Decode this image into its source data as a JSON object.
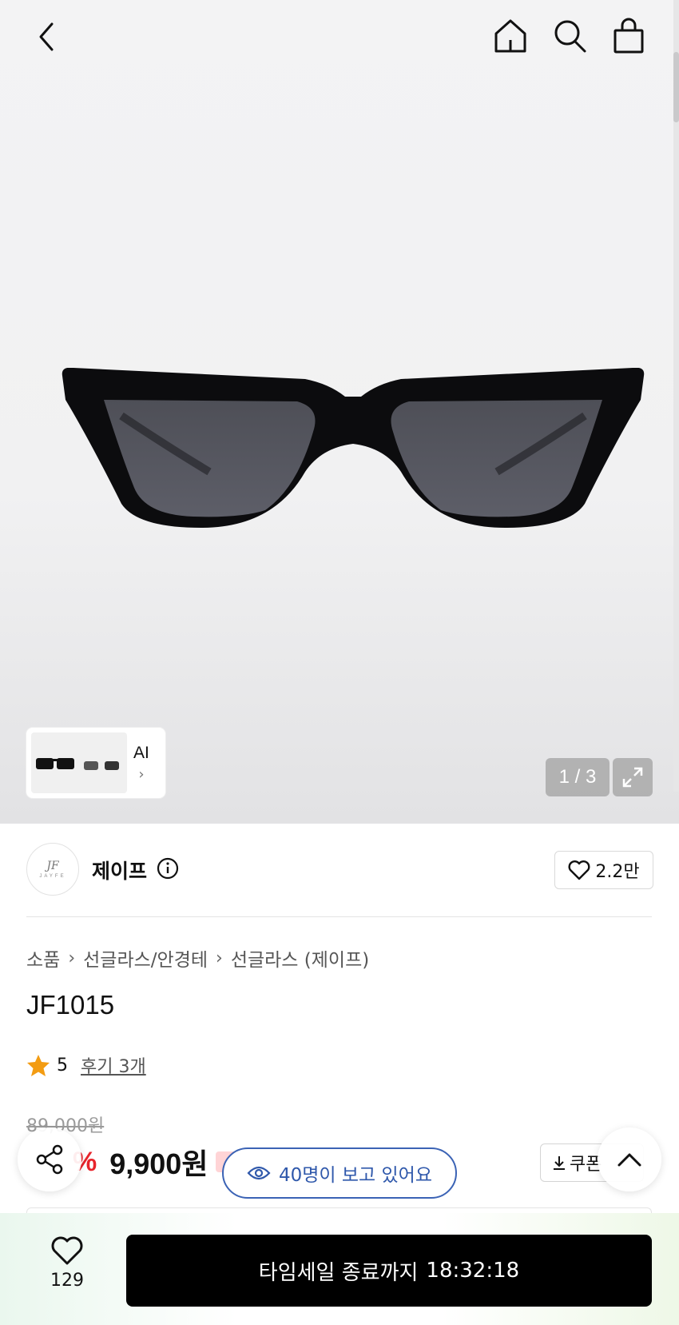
{
  "gallery": {
    "thumb_label": "AI",
    "thumb_chevron": "›",
    "pager": "1 / 3"
  },
  "brand": {
    "name": "제이프",
    "logo_mark": "JF",
    "logo_sub": "JAYFE",
    "like_count": "2.2만"
  },
  "breadcrumb": [
    "소품",
    "선글라스/안경테",
    "선글라스 (제이프)"
  ],
  "breadcrumb_sep": "›",
  "product": {
    "title": "JF1015",
    "rating": "5",
    "reviews": "후기 3개",
    "original_price": "89,000원",
    "discount": "%",
    "price": "9,900원"
  },
  "coupon": {
    "label": "쿠폰"
  },
  "viewers": {
    "text": "40명이 보고 있어요"
  },
  "bottom": {
    "wish_count": "129",
    "cta_label": "타임세일 종료까지",
    "cta_time": "18:32:18"
  },
  "colors": {
    "discount_red": "#e8242b",
    "viewer_blue": "#2f58ab",
    "star_orange": "#f39c12",
    "cta_black": "#000000"
  },
  "icons": {
    "back": "chevron-left-icon",
    "home": "home-icon",
    "search": "search-icon",
    "bag": "shopping-bag-icon",
    "expand": "expand-icon",
    "info": "info-icon",
    "heart": "heart-icon",
    "star": "star-icon",
    "download": "download-icon",
    "share": "share-icon",
    "up": "chevron-up-icon",
    "eye": "eye-icon"
  }
}
